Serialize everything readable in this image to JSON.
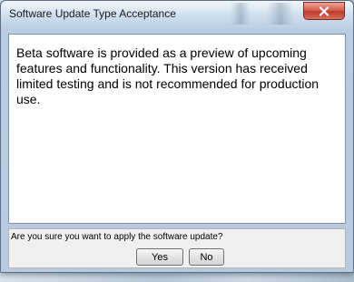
{
  "dialog": {
    "title": "Software Update Type Acceptance",
    "close_icon": "close-icon",
    "message": "Beta software is provided as a preview of upcoming features and functionality. This version has received limited testing and is not recommended for production use.",
    "question": "Are you sure you want to apply the software update?",
    "yes_label": "Yes",
    "no_label": "No"
  },
  "colors": {
    "close_button": "#c0392b",
    "content_background": "#ffffff",
    "button_area_background": "#f0f0f0"
  }
}
